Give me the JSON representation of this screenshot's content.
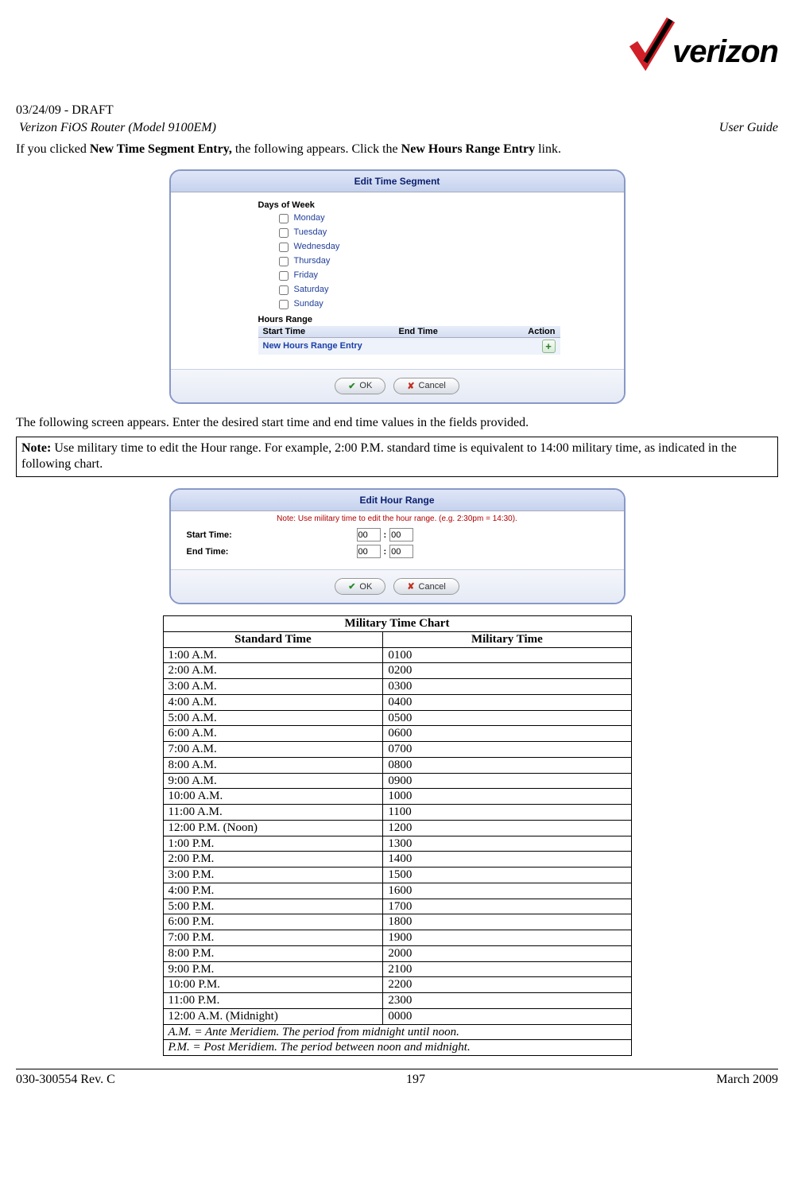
{
  "brand": {
    "name": "verizon"
  },
  "header": {
    "draft_line": "03/24/09 - DRAFT",
    "product_line": "Verizon FiOS Router (Model 9100EM)",
    "doc_type": "User Guide"
  },
  "intro": {
    "prefix": "If you clicked ",
    "bold1": "New Time Segment Entry,",
    "mid": " the following appears. Click the ",
    "bold2": "New Hours Range Entry",
    "suffix": " link."
  },
  "time_segment_panel": {
    "title": "Edit Time Segment",
    "days_label": "Days of Week",
    "days": [
      "Monday",
      "Tuesday",
      "Wednesday",
      "Thursday",
      "Friday",
      "Saturday",
      "Sunday"
    ],
    "hours_label": "Hours Range",
    "columns": {
      "start": "Start Time",
      "end": "End Time",
      "action": "Action"
    },
    "new_entry_label": "New Hours Range Entry",
    "ok_label": "OK",
    "cancel_label": "Cancel"
  },
  "between_text": "The following screen appears. Enter the desired start time and end time values in the fields provided.",
  "note_box": {
    "bold": "Note:",
    "text": " Use military time to edit the Hour range. For example, 2:00 P.M. standard time is equivalent to 14:00 military time, as indicated in the following chart."
  },
  "hour_range_panel": {
    "title": "Edit Hour Range",
    "note_line": "Note: Use military time to edit the hour range. (e.g. 2:30pm = 14:30).",
    "start_label": "Start Time:",
    "end_label": "End Time:",
    "start_hh": "00",
    "start_mm": "00",
    "end_hh": "00",
    "end_mm": "00",
    "ok_label": "OK",
    "cancel_label": "Cancel"
  },
  "chart_data": {
    "type": "table",
    "title": "Military Time Chart",
    "columns": [
      "Standard Time",
      "Military Time"
    ],
    "rows": [
      {
        "standard": "1:00 A.M.",
        "military": "0100"
      },
      {
        "standard": "2:00 A.M.",
        "military": "0200"
      },
      {
        "standard": "3:00 A.M.",
        "military": "0300"
      },
      {
        "standard": "4:00 A.M.",
        "military": "0400"
      },
      {
        "standard": "5:00 A.M.",
        "military": "0500"
      },
      {
        "standard": "6:00 A.M.",
        "military": "0600"
      },
      {
        "standard": "7:00 A.M.",
        "military": "0700"
      },
      {
        "standard": "8:00 A.M.",
        "military": "0800"
      },
      {
        "standard": "9:00 A.M.",
        "military": "0900"
      },
      {
        "standard": "10:00 A.M.",
        "military": "1000"
      },
      {
        "standard": "11:00 A.M.",
        "military": "1100"
      },
      {
        "standard": "12:00 P.M. (Noon)",
        "military": "1200"
      },
      {
        "standard": "1:00 P.M.",
        "military": "1300"
      },
      {
        "standard": "2:00 P.M.",
        "military": "1400"
      },
      {
        "standard": "3:00 P.M.",
        "military": "1500"
      },
      {
        "standard": "4:00 P.M.",
        "military": "1600"
      },
      {
        "standard": "5:00 P.M.",
        "military": "1700"
      },
      {
        "standard": "6:00 P.M.",
        "military": "1800"
      },
      {
        "standard": "7:00 P.M.",
        "military": "1900"
      },
      {
        "standard": "8:00 P.M.",
        "military": "2000"
      },
      {
        "standard": "9:00 P.M.",
        "military": "2100"
      },
      {
        "standard": "10:00 P.M.",
        "military": "2200"
      },
      {
        "standard": "11:00 P.M.",
        "military": "2300"
      },
      {
        "standard": "12:00 A.M. (Midnight)",
        "military": "0000"
      }
    ],
    "definitions": {
      "am": "A.M. = Ante Meridiem. The period from midnight until noon.",
      "pm": "P.M. = Post Meridiem. The period between noon and midnight."
    }
  },
  "footer": {
    "left": "030-300554 Rev. C",
    "center": "197",
    "right": "March 2009"
  }
}
